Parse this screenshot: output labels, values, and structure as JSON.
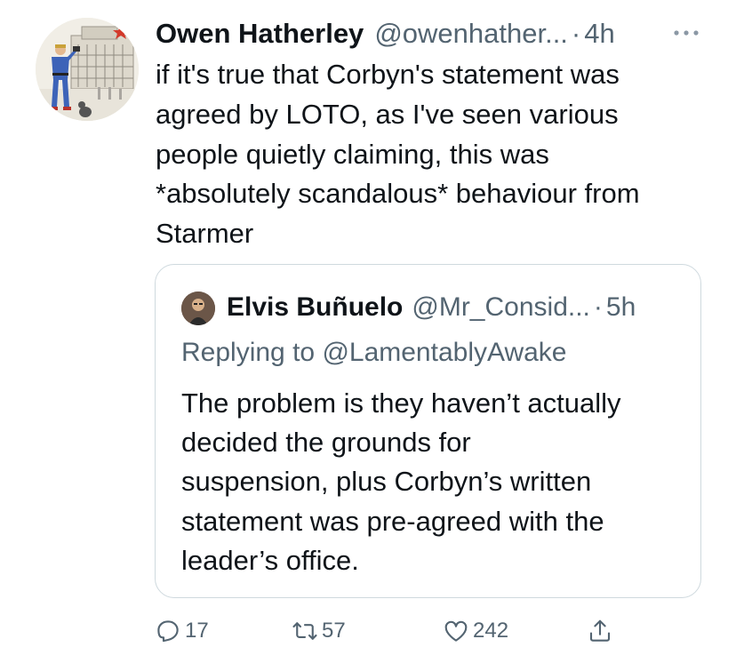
{
  "tweet": {
    "author_name": "Owen Hatherley",
    "author_handle": "@owenhather...",
    "dot": "·",
    "time": "4h",
    "more_icon": "more-horizontal-icon",
    "text_lines": [
      "if it's true that Corbyn's statement was",
      "agreed by LOTO, as I've seen various",
      "people quietly claiming, this was",
      "*absolutely scandalous* behaviour from",
      "Starmer"
    ]
  },
  "quote": {
    "author_name": "Elvis Buñuelo",
    "author_handle": "@Mr_Consid...",
    "dot": "·",
    "time": "5h",
    "replying_prefix": "Replying to ",
    "replying_to": "@LamentablyAwake",
    "text_lines": [
      "The problem is they haven’t actually",
      "decided the grounds for",
      "suspension, plus Corbyn’s written",
      "statement was pre-agreed with the",
      "leader’s office."
    ]
  },
  "actions": {
    "reply_count": "17",
    "retweet_count": "57",
    "like_count": "242",
    "icons": [
      "reply-icon",
      "retweet-icon",
      "like-icon",
      "share-icon"
    ]
  },
  "colors": {
    "text": "#0f1419",
    "secondary": "#536471",
    "border": "#cfd9de"
  }
}
